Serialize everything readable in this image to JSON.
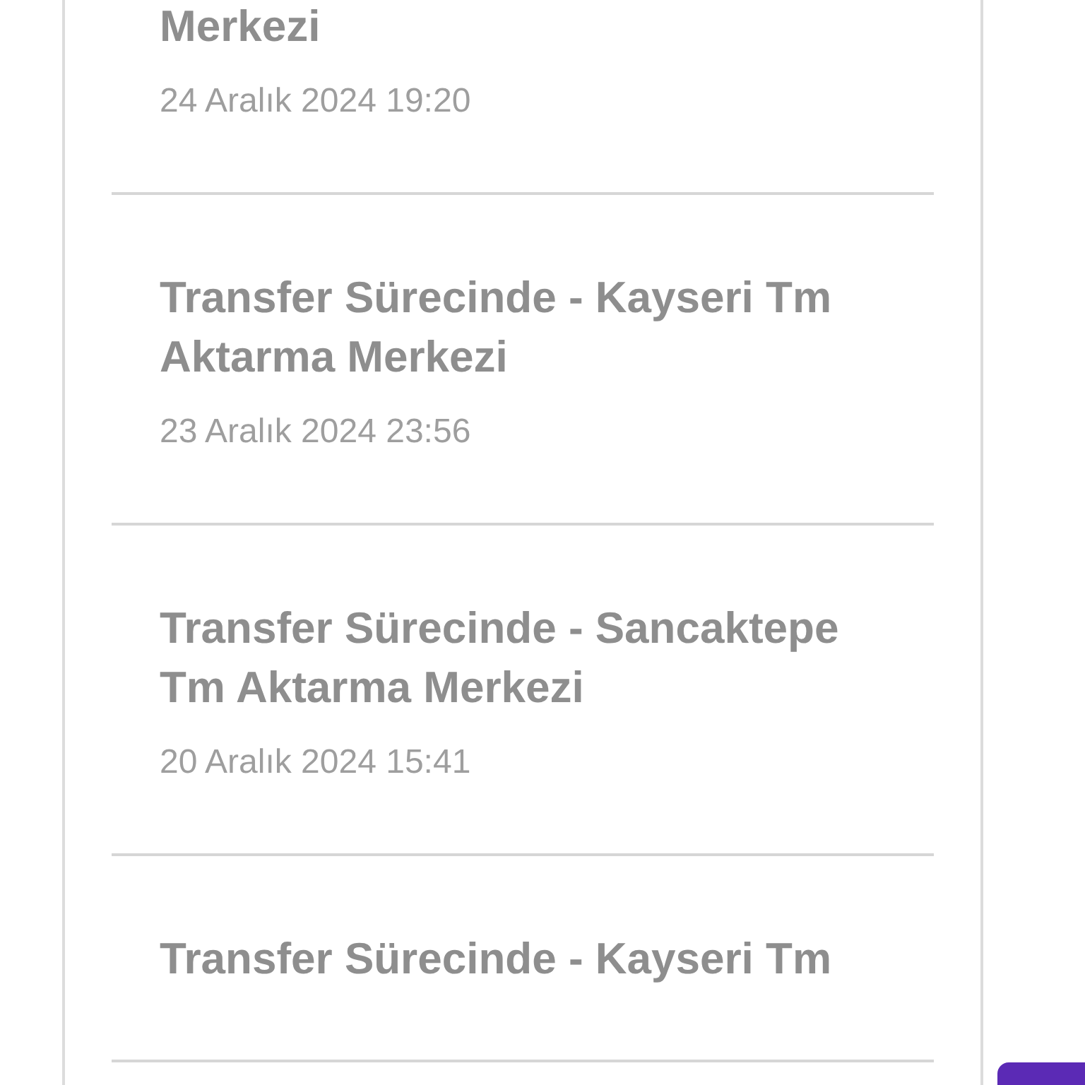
{
  "events": [
    {
      "title": "Merkezi",
      "date": "24 Aralık 2024 19:20"
    },
    {
      "title": "Transfer Sürecinde - Kayseri Tm Aktarma Merkezi",
      "date": "23 Aralık 2024 23:56"
    },
    {
      "title": "Transfer Sürecinde - Sancaktepe Tm Aktarma Merkezi",
      "date": "20 Aralık 2024 15:41"
    },
    {
      "title": "Transfer Sürecinde - Kayseri Tm"
    }
  ]
}
